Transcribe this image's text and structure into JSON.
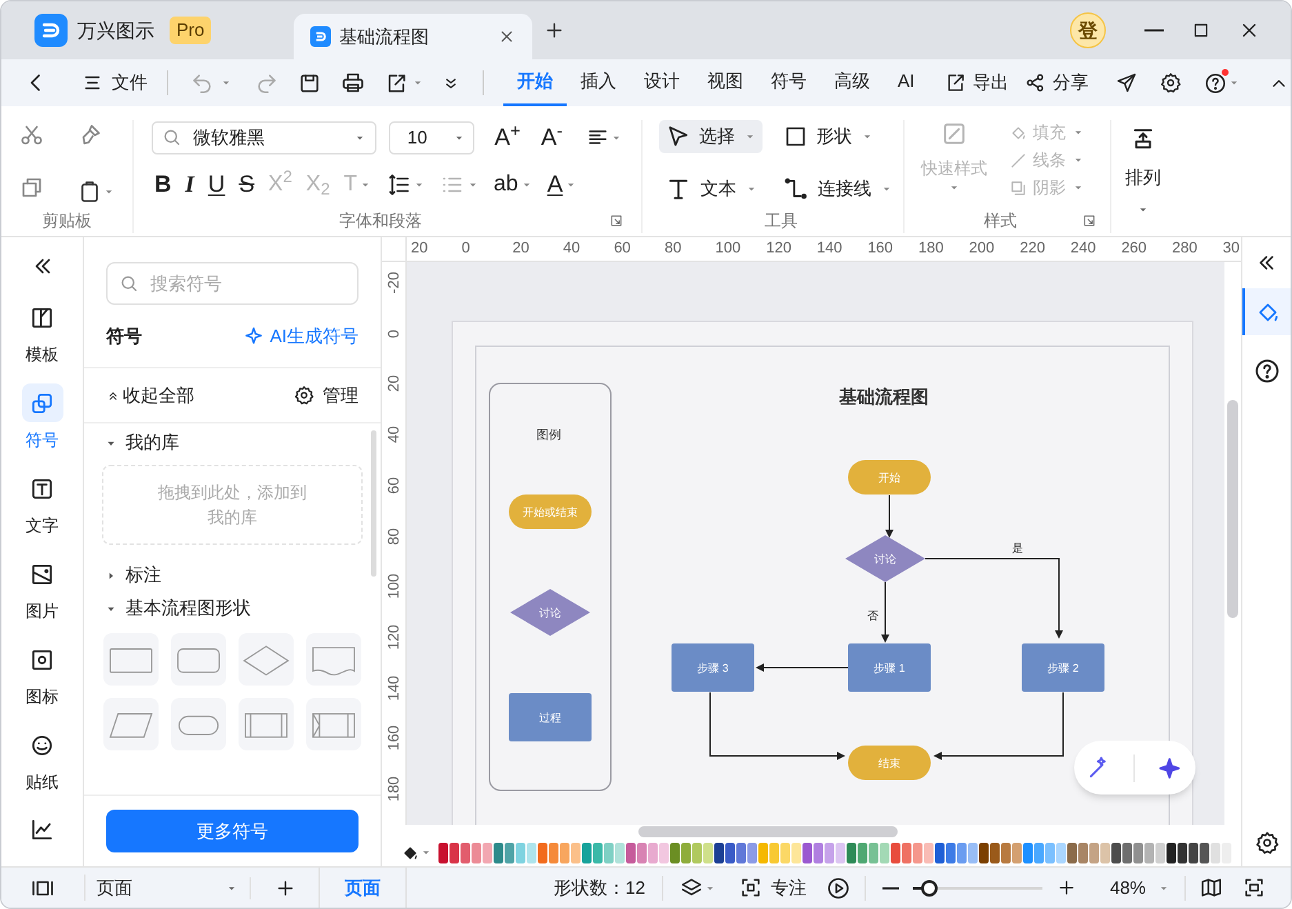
{
  "title_bar": {
    "app_name": "万兴图示",
    "badge": "Pro",
    "tabs": [
      {
        "title": "基础流程图",
        "selected": true
      }
    ],
    "avatar": "登"
  },
  "menu_bar": {
    "file": "文件",
    "tabs": [
      {
        "label": "开始",
        "selected": true
      },
      {
        "label": "插入",
        "selected": false
      },
      {
        "label": "设计",
        "selected": false
      },
      {
        "label": "视图",
        "selected": false
      },
      {
        "label": "符号",
        "selected": false
      },
      {
        "label": "高级",
        "selected": false
      },
      {
        "label": "AI",
        "selected": false
      }
    ],
    "actions": [
      {
        "kind": "export",
        "label": "导出"
      },
      {
        "kind": "share",
        "label": "分享"
      }
    ]
  },
  "ribbon": {
    "font": "微软雅黑",
    "font_size": "10",
    "size_buttons": [
      {
        "label": "A$^{+}$"
      },
      {
        "label": "A$^{-}$"
      }
    ],
    "format_buttons": [
      {
        "kind": "bold",
        "label": "B",
        "disabled": false,
        "dropdown": false
      },
      {
        "kind": "italic",
        "label": "I",
        "disabled": false,
        "dropdown": false
      },
      {
        "kind": "underline",
        "label": "U",
        "disabled": false,
        "dropdown": false
      },
      {
        "kind": "strike",
        "label": "S",
        "disabled": false,
        "dropdown": false
      },
      {
        "kind": "plain",
        "label": "X$^{2}$",
        "disabled": true,
        "dropdown": false
      },
      {
        "kind": "plain",
        "label": "X$_{2}$",
        "disabled": true,
        "dropdown": false
      },
      {
        "kind": "plain",
        "label": "T",
        "disabled": true,
        "dropdown": true
      },
      {
        "kind": "line_spacing",
        "disabled": false,
        "dropdown": true
      },
      {
        "kind": "list",
        "disabled": true,
        "dropdown": true
      },
      {
        "kind": "plain",
        "label": "ab",
        "disabled": false,
        "dropdown": true
      },
      {
        "kind": "underline",
        "label": "A",
        "disabled": false,
        "dropdown": true
      }
    ],
    "groups": [
      {
        "label": "剪贴板"
      },
      {
        "label": "字体和段落"
      },
      {
        "label": "工具"
      },
      {
        "label": "样式"
      }
    ],
    "tools": [
      {
        "kind": "select",
        "label": "选择",
        "selected": true
      },
      {
        "kind": "shape",
        "label": "形状",
        "selected": false
      },
      {
        "kind": "text",
        "label": "文本",
        "selected": false
      },
      {
        "kind": "connector",
        "label": "连接线",
        "selected": false
      }
    ],
    "quick_style": {
      "label": "快速样式",
      "disabled": true
    },
    "style_options": [
      {
        "kind": "fill",
        "label": "填充",
        "disabled": true
      },
      {
        "kind": "line",
        "label": "线条",
        "disabled": true
      },
      {
        "kind": "shadow",
        "label": "阴影",
        "disabled": true
      }
    ],
    "arrange": "排列"
  },
  "left_rail": [
    {
      "kind": "template",
      "label": "模板",
      "selected": false
    },
    {
      "kind": "symbol",
      "label": "符号",
      "selected": true
    },
    {
      "kind": "text",
      "label": "文字",
      "selected": false
    },
    {
      "kind": "image",
      "label": "图片",
      "selected": false
    },
    {
      "kind": "icon",
      "label": "图标",
      "selected": false
    },
    {
      "kind": "sticker",
      "label": "贴纸",
      "selected": false
    }
  ],
  "symbol_panel": {
    "search_placeholder": "搜索符号",
    "heading": "符号",
    "ai_button": "AI生成符号",
    "collapse_all": "收起全部",
    "manage": "管理",
    "sections": [
      {
        "title": "我的库",
        "expanded": true,
        "hint": "拖拽到此处，添加到我的库"
      },
      {
        "title": "标注",
        "expanded": false
      },
      {
        "title": "基本流程图形状",
        "expanded": true
      }
    ],
    "more_button": "更多符号"
  },
  "canvas": {
    "top_ruler": [
      "20",
      "0",
      "20",
      "40",
      "60",
      "80",
      "100",
      "120",
      "140",
      "160",
      "180",
      "200",
      "220",
      "240",
      "260",
      "280",
      "30"
    ],
    "left_ruler": [
      "-20",
      "0",
      "20",
      "40",
      "60",
      "80",
      "100",
      "120",
      "140",
      "160",
      "180"
    ],
    "diagram": {
      "title": "基础流程图",
      "legend": {
        "title": "图例",
        "items": [
          {
            "kind": "terminator",
            "label": "开始或结束"
          },
          {
            "kind": "decision",
            "label": "讨论"
          },
          {
            "kind": "process",
            "label": "过程"
          }
        ]
      },
      "nodes": [
        {
          "kind": "terminator",
          "label": "开始"
        },
        {
          "kind": "decision",
          "label": "讨论"
        },
        {
          "kind": "process",
          "label": "步骤 3"
        },
        {
          "kind": "process",
          "label": "步骤 1"
        },
        {
          "kind": "process",
          "label": "步骤 2"
        },
        {
          "kind": "terminator",
          "label": "结束"
        }
      ],
      "edge_labels": [
        "是",
        "否"
      ]
    }
  },
  "palette": [
    {
      "color": "#c8102e"
    },
    {
      "color": "#d93448"
    },
    {
      "color": "#e25d6d"
    },
    {
      "color": "#ec8b96"
    },
    {
      "color": "#f2a7b1"
    },
    {
      "color": "#2d8a8a"
    },
    {
      "color": "#4fa3a6"
    },
    {
      "color": "#7fd3e0"
    },
    {
      "color": "#aee4ec"
    },
    {
      "color": "#f26b1d"
    },
    {
      "color": "#f58a3a"
    },
    {
      "color": "#f8a65e"
    },
    {
      "color": "#fbc08a"
    },
    {
      "color": "#18a39b"
    },
    {
      "color": "#3bb9a8"
    },
    {
      "color": "#7fd0c4"
    },
    {
      "color": "#b0e2da"
    },
    {
      "color": "#c65b9b"
    },
    {
      "color": "#d883b3"
    },
    {
      "color": "#e8aacf"
    },
    {
      "color": "#f2c7e0"
    },
    {
      "color": "#6b8e23"
    },
    {
      "color": "#8fad3b"
    },
    {
      "color": "#b0c95e"
    },
    {
      "color": "#cfe08a"
    },
    {
      "color": "#1c3f94"
    },
    {
      "color": "#3a5bc7"
    },
    {
      "color": "#6078d8"
    },
    {
      "color": "#8c9be6"
    },
    {
      "color": "#f5b800"
    },
    {
      "color": "#f8c933"
    },
    {
      "color": "#fbd866"
    },
    {
      "color": "#fde699"
    },
    {
      "color": "#9b59d0"
    },
    {
      "color": "#b07fe0"
    },
    {
      "color": "#c6a2ea"
    },
    {
      "color": "#dcc5f2"
    },
    {
      "color": "#2e8b57"
    },
    {
      "color": "#4fa872"
    },
    {
      "color": "#77c194"
    },
    {
      "color": "#a3d9b5"
    },
    {
      "color": "#e84c3d"
    },
    {
      "color": "#ef7163"
    },
    {
      "color": "#f5978c"
    },
    {
      "color": "#f9bcb5"
    },
    {
      "color": "#1f5fd6"
    },
    {
      "color": "#3d7be6"
    },
    {
      "color": "#6a9cf0"
    },
    {
      "color": "#98bdf6"
    },
    {
      "color": "#7b3f00"
    },
    {
      "color": "#9a5a1a"
    },
    {
      "color": "#b87a40"
    },
    {
      "color": "#d4a070"
    },
    {
      "color": "#1e90ff"
    },
    {
      "color": "#4aa8ff"
    },
    {
      "color": "#7bc0ff"
    },
    {
      "color": "#aad6ff"
    },
    {
      "color": "#8b6b4a"
    },
    {
      "color": "#a88565"
    },
    {
      "color": "#c4a385"
    },
    {
      "color": "#dcc3a8"
    },
    {
      "color": "#4d4d4d"
    },
    {
      "color": "#6e6e6e"
    },
    {
      "color": "#909090"
    },
    {
      "color": "#b3b3b3"
    },
    {
      "color": "#d0d0d0"
    },
    {
      "color": "#222222"
    },
    {
      "color": "#333333"
    },
    {
      "color": "#444444"
    },
    {
      "color": "#555555"
    },
    {
      "color": "#e0e0e0"
    },
    {
      "color": "#eeeeee"
    }
  ],
  "status_bar": {
    "page_menu": "页面",
    "pages": [
      {
        "label": "页面",
        "selected": true
      }
    ],
    "shape_count": "形状数：12",
    "focus": "专注",
    "zoom": {
      "level": 0.13,
      "reading": "48%"
    }
  }
}
